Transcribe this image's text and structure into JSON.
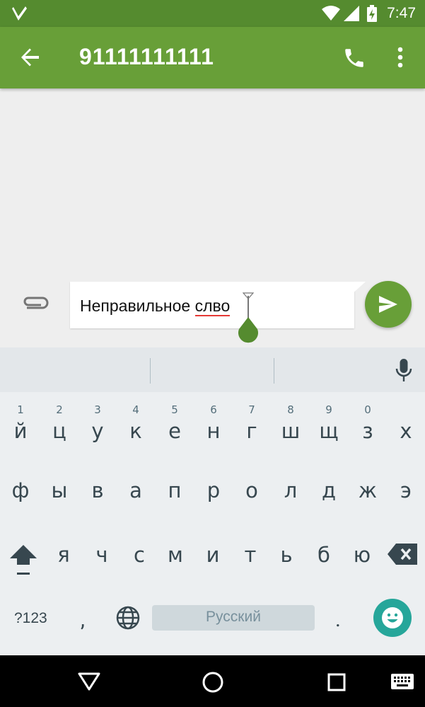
{
  "status_bar": {
    "time": "7:47",
    "icons": [
      "app-notification-icon",
      "wifi-icon",
      "signal-icon",
      "battery-charging-icon"
    ]
  },
  "toolbar": {
    "title": "91111111111",
    "icons": [
      "back-arrow-icon",
      "phone-icon",
      "more-vert-icon"
    ]
  },
  "compose": {
    "text_before": "Неправильное ",
    "misspelled_word": "слво",
    "icons": [
      "paperclip-icon",
      "send-icon"
    ]
  },
  "keyboard": {
    "row1": [
      {
        "key": "й",
        "hint": "1"
      },
      {
        "key": "ц",
        "hint": "2"
      },
      {
        "key": "у",
        "hint": "3"
      },
      {
        "key": "к",
        "hint": "4"
      },
      {
        "key": "е",
        "hint": "5"
      },
      {
        "key": "н",
        "hint": "6"
      },
      {
        "key": "г",
        "hint": "7"
      },
      {
        "key": "ш",
        "hint": "8"
      },
      {
        "key": "щ",
        "hint": "9"
      },
      {
        "key": "з",
        "hint": "0"
      },
      {
        "key": "х",
        "hint": ""
      }
    ],
    "row2": [
      "ф",
      "ы",
      "в",
      "а",
      "п",
      "р",
      "о",
      "л",
      "д",
      "ж",
      "э"
    ],
    "row3": [
      "я",
      "ч",
      "с",
      "м",
      "и",
      "т",
      "ь",
      "б",
      "ю"
    ],
    "symbols_label": "?123",
    "comma": ",",
    "space_label": "Русский",
    "period": ".",
    "icons": [
      "mic-icon",
      "shift-icon",
      "backspace-icon",
      "globe-icon",
      "emoji-icon"
    ]
  },
  "nav_bar": {
    "icons": [
      "nav-back-icon",
      "nav-home-icon",
      "nav-recents-icon",
      "keyboard-switch-icon"
    ]
  },
  "colors": {
    "status_bar": "#558b2f",
    "toolbar": "#689f38",
    "send": "#689f38",
    "emoji": "#26a69a",
    "spell_underline": "#e53935"
  }
}
